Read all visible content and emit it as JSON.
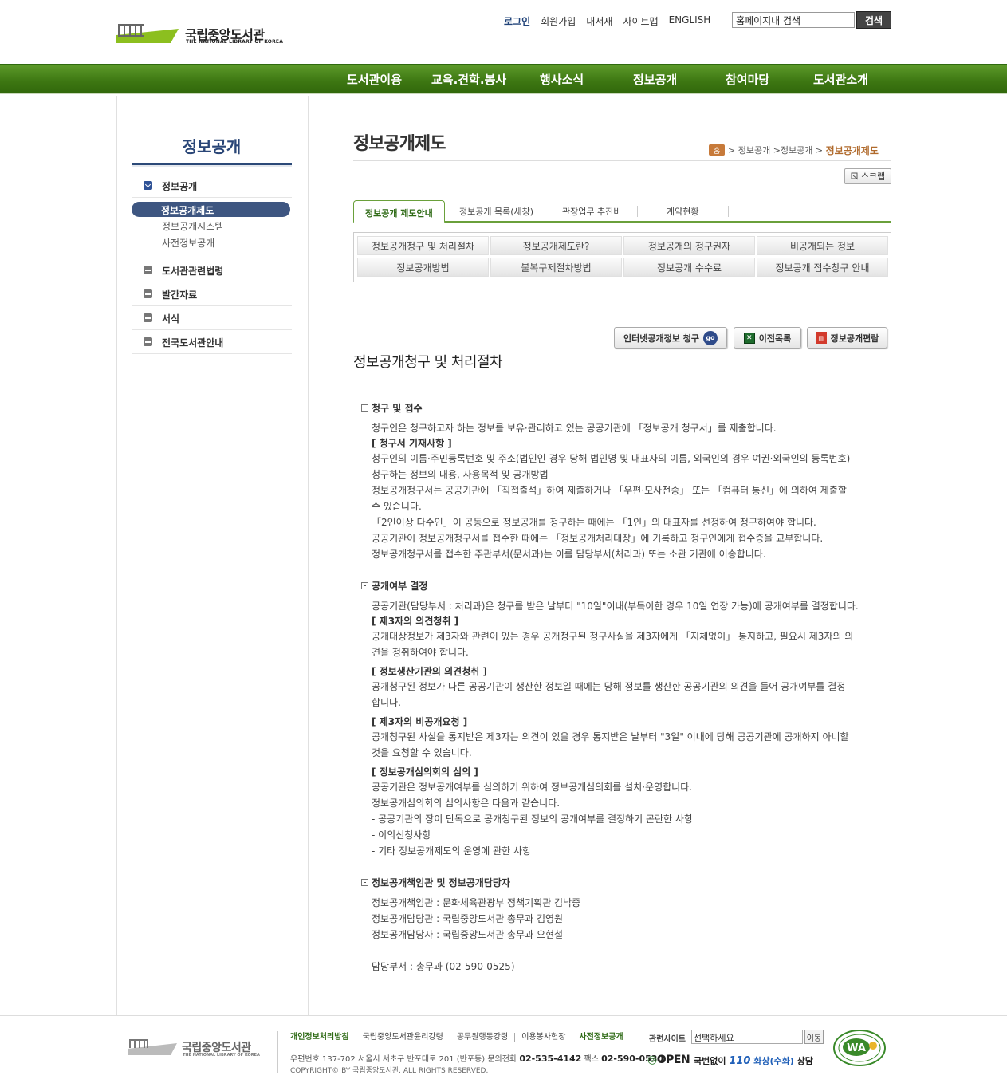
{
  "header": {
    "logo_ko": "국립중앙도서관",
    "logo_en": "THE NATIONAL LIBRARY OF KOREA",
    "util_links": [
      "로그인",
      "회원가입",
      "내서재",
      "사이트맵",
      "ENGLISH"
    ],
    "search_value": "홈페이지내 검색",
    "search_button": "검색"
  },
  "gnb": [
    "도서관이용",
    "교육.견학.봉사",
    "행사소식",
    "정보공개",
    "참여마당",
    "도서관소개"
  ],
  "lnb": {
    "title": "정보공개",
    "items": [
      {
        "label": "정보공개",
        "state": "open"
      },
      {
        "label": "도서관관련법령",
        "state": "closed"
      },
      {
        "label": "발간자료",
        "state": "closed"
      },
      {
        "label": "서식",
        "state": "closed"
      },
      {
        "label": "전국도서관안내",
        "state": "closed"
      }
    ],
    "sub_items": [
      "정보공개제도",
      "정보공개시스템",
      "사전정보공개"
    ]
  },
  "content": {
    "page_title": "정보공개제도",
    "breadcrumb": {
      "home": "홈",
      "items": [
        "정보공개",
        "정보공개"
      ],
      "current": "정보공개제도"
    },
    "scrap_button": "스크랩",
    "tabs": [
      "정보공개 제도안내",
      "정보공개 목록(새창)",
      "관장업무 추진비",
      "계약현황"
    ],
    "subnav": [
      [
        "정보공개청구 및 처리절차",
        "정보공개제도란?",
        "정보공개의 청구권자",
        "비공개되는 정보"
      ],
      [
        "정보공개방법",
        "불복구제절차방법",
        "정보공개 수수료",
        "정보공개 접수창구 안내"
      ]
    ],
    "action_buttons": {
      "internet_request": "인터넷공개정보 청구",
      "go": "go",
      "prev_list": "이전목록",
      "handbook": "정보공개편람"
    },
    "section_title": "정보공개청구 및 처리절차",
    "sections": [
      {
        "heading": "청구 및 접수",
        "lines": [
          {
            "t": "청구인은 청구하고자 하는 정보를 보유·관리하고 있는 공공기관에 「정보공개 청구서」를 제출합니다.",
            "b": false
          },
          {
            "t": "[ 청구서 기재사항 ]",
            "b": true
          },
          {
            "t": "청구인의 이름·주민등록번호 및 주소(법인인 경우 당해 법인명 및 대표자의 이름, 외국인의 경우 여권·외국인의 등록번호)",
            "b": false
          },
          {
            "t": "청구하는 정보의 내용, 사용목적 및 공개방법",
            "b": false
          },
          {
            "t": "정보공개청구서는 공공기관에 「직접출석」하여 제출하거나 「우편·모사전송」 또는 「컴퓨터 통신」에 의하여 제출할",
            "b": false
          },
          {
            "t": "수 있습니다.",
            "b": false
          },
          {
            "t": "「2인이상 다수인」이 공동으로 정보공개를 청구하는 때에는 「1인」의 대표자를 선정하여 청구하여야 합니다.",
            "b": false
          },
          {
            "t": "공공기관이 정보공개청구서를 접수한 때에는 「정보공개처리대장」에 기록하고 청구인에게 접수증을 교부합니다.",
            "b": false
          },
          {
            "t": "정보공개청구서를 접수한 주관부서(문서과)는 이를 담당부서(처리과) 또는 소관 기관에 이송합니다.",
            "b": false
          }
        ]
      },
      {
        "heading": "공개여부 결정",
        "lines": [
          {
            "t": "공공기관(담당부서 : 처리과)은 청구를 받은 날부터 \"10일\"이내(부득이한 경우 10일 연장 가능)에 공개여부를 결정합니다.",
            "b": false
          },
          {
            "t": "[ 제3자의 의견청취 ]",
            "b": true
          },
          {
            "t": "공개대상정보가 제3자와 관련이 있는 경우 공개청구된 청구사실을 제3자에게 「지체없이」 통지하고, 필요시 제3자의 의",
            "b": false
          },
          {
            "t": "견을 청취하여야 합니다.",
            "b": false
          },
          {
            "t": "[ 정보생산기관의 의견청취 ]",
            "b": true
          },
          {
            "t": "공개청구된 정보가 다른 공공기관이 생산한 정보일 때에는 당해 정보를 생산한 공공기관의 의견을 들어 공개여부를 결정",
            "b": false
          },
          {
            "t": "합니다.",
            "b": false
          },
          {
            "t": "[ 제3자의 비공개요청 ]",
            "b": true
          },
          {
            "t": "공개청구된 사실을 통지받은 제3자는 의견이 있을 경우 통지받은 날부터 \"3일\" 이내에 당해 공공기관에 공개하지 아니할",
            "b": false
          },
          {
            "t": "것을 요청할 수 있습니다.",
            "b": false
          },
          {
            "t": "[ 정보공개심의회의 심의 ]",
            "b": true
          },
          {
            "t": "공공기관은 정보공개여부를 심의하기 위하여 정보공개심의회를 설치·운영합니다.",
            "b": false
          },
          {
            "t": "정보공개심의회의 심의사항은 다음과 같습니다.",
            "b": false
          },
          {
            "t": "- 공공기관의 장이 단독으로 공개청구된 정보의 공개여부를 결정하기 곤란한 사항",
            "b": false
          },
          {
            "t": "- 이의신청사항",
            "b": false
          },
          {
            "t": "- 기타 정보공개제도의 운영에 관한 사항",
            "b": false
          }
        ]
      },
      {
        "heading": "정보공개책임관 및 정보공개담당자",
        "lines": [
          {
            "t": "정보공개책임관 : 문화체육관광부 정책기획관 김낙중",
            "b": false
          },
          {
            "t": "정보공개담당관 : 국립중앙도서관 총무과 김영원",
            "b": false
          },
          {
            "t": "정보공개담당자 : 국립중앙도서관 총무과 오현철",
            "b": false
          },
          {
            "t": "담당부서 : 총무과 (02-590-0525)",
            "b": false
          }
        ]
      }
    ]
  },
  "footer": {
    "logo_ko": "국립중앙도서관",
    "logo_en": "THE NATIONAL LIBRARY OF KOREA",
    "links": [
      "개인정보처리방침",
      "국립중앙도서관윤리강령",
      "공무원행동강령",
      "이용봉사헌장",
      "사전정보공개"
    ],
    "related_label": "관련사이트",
    "related_select": "선택하세요",
    "related_go": "이동",
    "address_prefix": "우편번호 137-702 서울시 서초구 반포대로 201 (반포동)  문의전화 ",
    "phone": "02-535-4142",
    "fax_label": " 팩스 ",
    "fax": "02-590-0530",
    "copyright": "COPYRIGHT© BY 국립중앙도서관. ALL RIGHTS RESERVED.",
    "open_logo": "OPEN",
    "call_prefix": "국번없이 ",
    "call_number": "110",
    "call_suffix_hl": " 화상(수화)",
    "call_suffix": " 상담",
    "wa_badge": "WA"
  },
  "colors": {
    "gnb": "#3d7712",
    "lnb_active": "#3e5681",
    "tab_active": "#2e6a15"
  }
}
